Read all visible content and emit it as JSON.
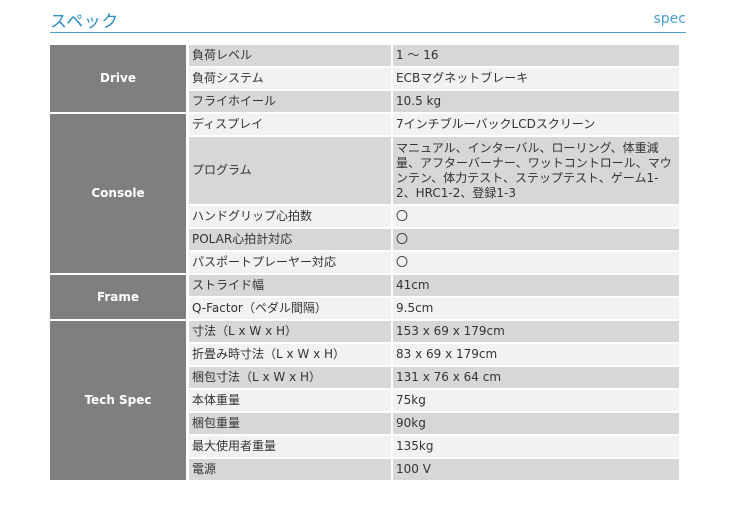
{
  "header": {
    "title": "スペック",
    "subtitle": "spec"
  },
  "groups": {
    "drive": "Drive",
    "console": "Console",
    "frame": "Frame",
    "tech": "Tech Spec"
  },
  "rows": [
    {
      "label": "負荷レベル",
      "value": "1 〜 16"
    },
    {
      "label": "負荷システム",
      "value": "ECBマグネットブレーキ"
    },
    {
      "label": "フライホイール",
      "value": "10.5 kg"
    },
    {
      "label": "ディスプレイ",
      "value": "7インチブルーバックLCDスクリーン"
    },
    {
      "label": "プログラム",
      "value": "マニュアル、インターバル、ローリング、体重減量、アフターバーナー、ワットコントロール、マウンテン、体力テスト、ステップテスト、ゲーム1-2、HRC1-2、登録1-3"
    },
    {
      "label": "ハンドグリップ心拍数",
      "value": "〇"
    },
    {
      "label": "POLAR心拍計対応",
      "value": "〇"
    },
    {
      "label": "パスポートプレーヤー対応",
      "value": "〇"
    },
    {
      "label": "ストライド幅",
      "value": "41cm"
    },
    {
      "label": "Q-Factor（ペダル間隔）",
      "value": "9.5cm"
    },
    {
      "label": "寸法（L x W x H）",
      "value": "153 x 69 x 179cm"
    },
    {
      "label": "折畳み時寸法（L x W x H）",
      "value": "83 x 69 x 179cm"
    },
    {
      "label": "梱包寸法（L x W x H）",
      "value": "131 x 76 x 64 cm"
    },
    {
      "label": "本体重量",
      "value": "75kg"
    },
    {
      "label": "梱包重量",
      "value": "90kg"
    },
    {
      "label": "最大使用者重量",
      "value": "135kg"
    },
    {
      "label": "電源",
      "value": "100 V"
    }
  ]
}
